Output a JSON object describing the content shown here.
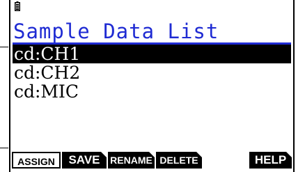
{
  "status_bar": {
    "battery_icon": "battery-icon"
  },
  "title": "Sample Data List",
  "list": [
    {
      "label": "cd:CH1",
      "selected": true
    },
    {
      "label": "cd:CH2",
      "selected": false
    },
    {
      "label": "cd:MIC",
      "selected": false
    }
  ],
  "function_keys": {
    "f1": "ASSIGN",
    "f2": "SAVE",
    "f3": "RENAME",
    "f4": "DELETE",
    "f6": "HELP"
  },
  "colors": {
    "title": "#1f2bd3",
    "highlight": "#000000",
    "background": "#ffffff"
  }
}
